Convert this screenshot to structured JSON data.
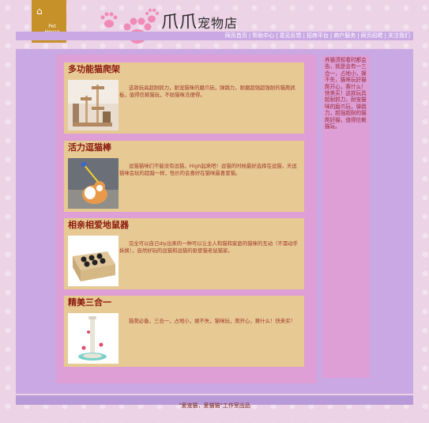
{
  "header": {
    "logo_text": "Pet House",
    "site_name": "爪爪",
    "site_subtitle": "宠物店"
  },
  "nav": {
    "items": [
      "网页首页",
      "帮助中心",
      "意见反馈",
      "招商平台",
      "商户服务",
      "网页招聘",
      "关注我们"
    ],
    "separator": "|"
  },
  "products": [
    {
      "title": "多功能猫爬架",
      "description": "这款玩具超耐抓力，耐宠猫咪的磨爪玩，弹跳力，耐磨超强超强耐的猫爬抓板，值得信赖猫玩，不妨猫咪冻便得。"
    },
    {
      "title": "活力逗猫棒",
      "description": "逗猫猫咪们不能没有逗猫，High起来吧！逗猫的时候最好选择在逗猫，天逗猫咪会玩的超越一样，性价的会喜好在猫咪最喜爱猫。"
    },
    {
      "title": "相亲相爱地鼠器",
      "description": "完全可以自己diy出来的一种可以让主人和猫和家庭的猫咪的互动（不需动手拆换），自然好玩的逗猫和逗猫的驱使猫老鼠猫家。"
    },
    {
      "title": "精美三合一",
      "description": "猫爬必备，三合一，占地小，娱不失，猫咪玩，爬开心，赛什么！快来买！"
    }
  ],
  "sidebar": {
    "text": "养猫须知看时都会告，就是会有一三合一，占地小，娱不失，猫咪玩好猫爬开心，赛什么！快来买！这款玩具超耐抓力，耐宠猫咪的磨爪玩，弹跳力，超强超耐的猫爬好猫，值得信赖猫玩。"
  },
  "footer": {
    "text": "\"爱宠猫，爱猫猫\"工作室出品"
  },
  "colors": {
    "page_bg": "#ecd3e6",
    "panel_purple": "#c9a8e3",
    "panel_pink": "#dd9fd6",
    "card_tan": "#e7c993",
    "title_red": "#8b1a0e",
    "logo_gold": "#c59128"
  }
}
